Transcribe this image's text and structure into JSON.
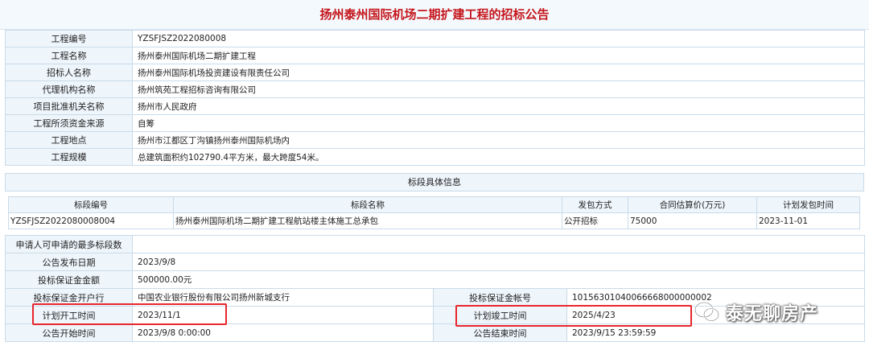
{
  "title": "扬州泰州国际机场二期扩建工程的招标公告",
  "project_info": [
    {
      "label": "工程编号",
      "value": "YZSFJSZ2022080008"
    },
    {
      "label": "工程名称",
      "value": "扬州泰州国际机场二期扩建工程"
    },
    {
      "label": "招标人名称",
      "value": "扬州泰州国际机场投资建设有限责任公司"
    },
    {
      "label": "代理机构名称",
      "value": "扬州筑苑工程招标咨询有限公司"
    },
    {
      "label": "项目批准机关名称",
      "value": "扬州市人民政府"
    },
    {
      "label": "工程所须资金来源",
      "value": "自筹"
    },
    {
      "label": "工程地点",
      "value": "扬州市江都区丁沟镇扬州泰州国际机场内"
    },
    {
      "label": "工程规模",
      "value": "总建筑面积约102790.4平方米，最大跨度54米。"
    }
  ],
  "section_header": "标段具体信息",
  "lots": {
    "headers": [
      "标段编号",
      "标段名称",
      "发包方式",
      "合同估算价(万元)",
      "计划发包时间"
    ],
    "rows": [
      [
        "YZSFJSZ2022080008004",
        "扬州泰州国际机场二期扩建工程航站楼主体施工总承包",
        "公开招标",
        "75000",
        "2023-11-01"
      ]
    ]
  },
  "details": {
    "max_lots_label": "申请人可申请的最多标段数",
    "max_lots_value": "",
    "publish_date_label": "公告发布日期",
    "publish_date_value": "2023/9/8",
    "deposit_amount_label": "投标保证金金额",
    "deposit_amount_value": "500000.00元",
    "deposit_bank_label": "投标保证金开户行",
    "deposit_bank_value": "中国农业银行股份有限公司扬州新城支行",
    "deposit_account_label": "投标保证金帐号",
    "deposit_account_value": "10156301040066668000000002",
    "start_label": "计划开工时间",
    "start_value": "2023/11/1",
    "finish_label": "计划竣工时间",
    "finish_value": "2025/4/23",
    "notice_start_label": "公告开始时间",
    "notice_start_value": "2023/9/8 0:00:00",
    "notice_end_label": "公告结束时间",
    "notice_end_value": "2023/9/15 23:59:59"
  },
  "watermark": "泰无聊房产",
  "colors": {
    "title": "#c4161c",
    "label_bg": "#eef5fb",
    "border": "#c9dbe9",
    "highlight": "#e8262b"
  }
}
